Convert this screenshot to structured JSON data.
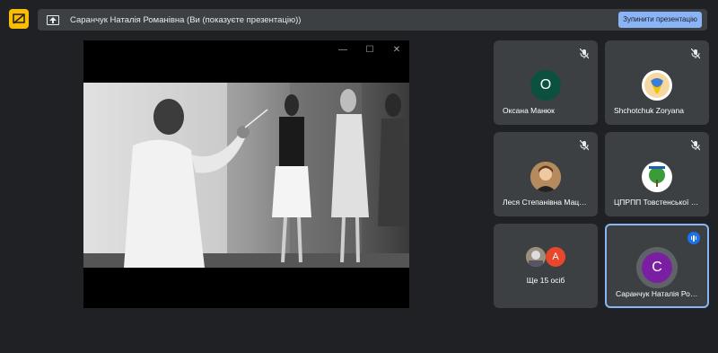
{
  "banner": {
    "title": "Саранчук Наталія Романівна (Ви (показуєте презентацію))",
    "stop_label": "Зупинити презентацію"
  },
  "window_controls": {
    "minimize": "—",
    "maximize": "☐",
    "close": "✕"
  },
  "participants": [
    {
      "name": "Оксана Манюк",
      "initial": "О",
      "avatar_color": "#0b5041",
      "muted": true
    },
    {
      "name": "Shchotchuk Zoryana",
      "initial": "",
      "avatar_color": "#fff",
      "muted": true
    },
    {
      "name": "Леся Степанівна Маценко",
      "initial": "",
      "avatar_color": "#c8a070",
      "muted": true
    },
    {
      "name": "ЦПРПП Товстенської селищної ради",
      "initial": "",
      "avatar_color": "#fff",
      "muted": true
    },
    {
      "name": "Саранчук Наталія Романівна",
      "initial": "С",
      "avatar_color": "#7b1fa2",
      "muted": false,
      "speaking": true
    }
  ],
  "more": {
    "label": "Ще 15 осіб",
    "initial": "А",
    "avatar_color": "#e8472b"
  },
  "colors": {
    "accent": "#8ab4f8",
    "tile_bg": "#3c4043",
    "background": "#202124"
  }
}
